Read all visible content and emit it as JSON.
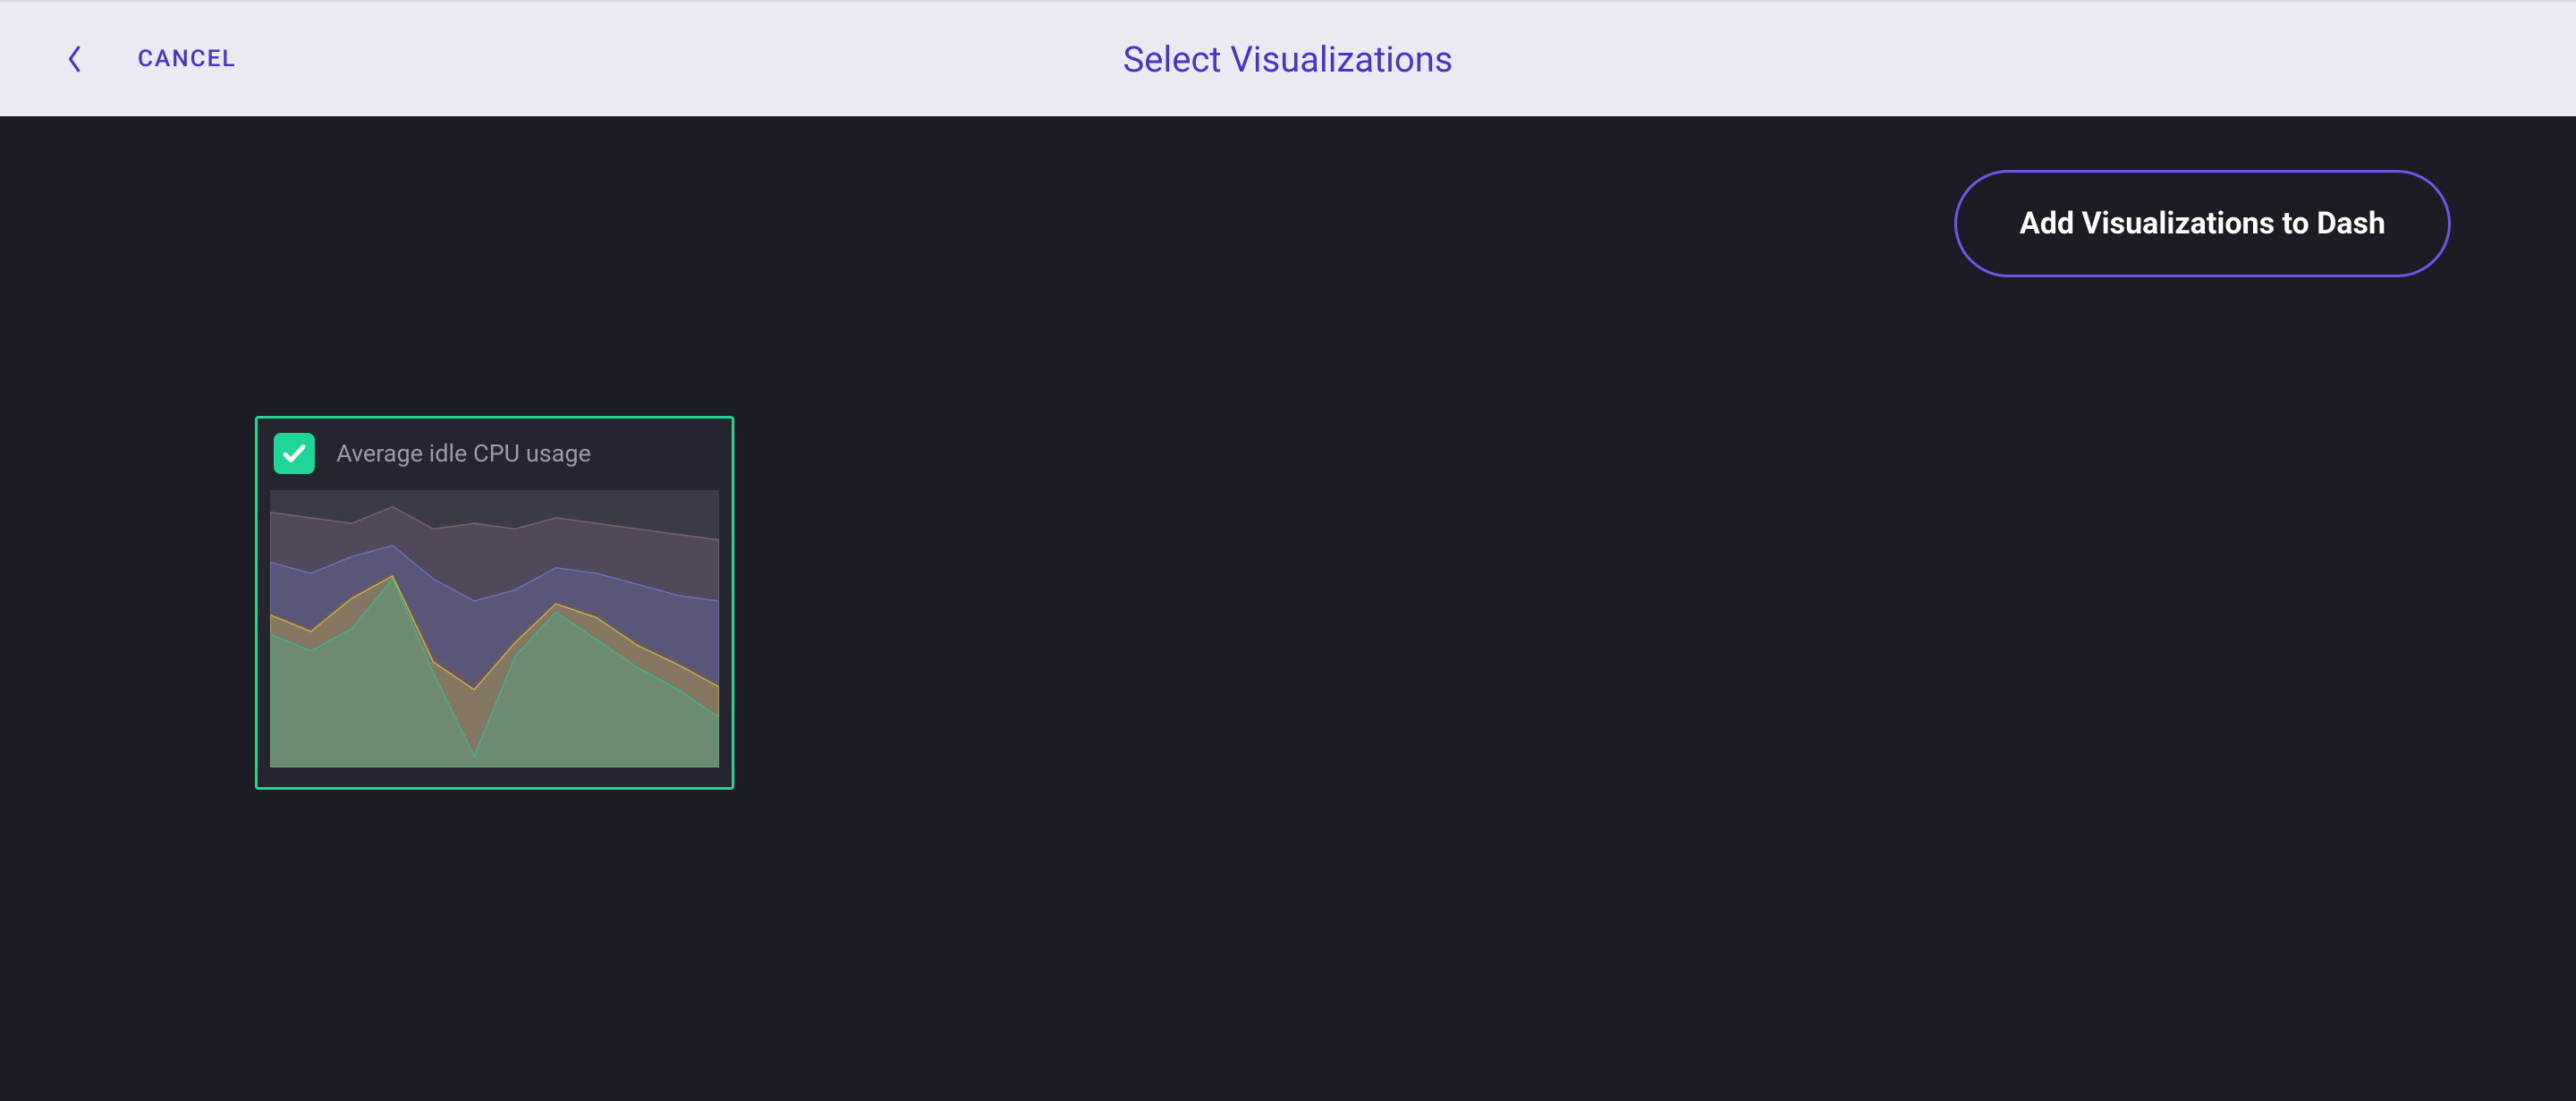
{
  "header": {
    "cancel_label": "CANCEL",
    "title": "Select Visualizations"
  },
  "actions": {
    "add_label": "Add Visualizations to Dash"
  },
  "visualizations": [
    {
      "title": "Average idle CPU usage",
      "selected": true
    }
  ],
  "chart_data": {
    "type": "area",
    "title": "Average idle CPU usage",
    "xlabel": "",
    "ylabel": "",
    "ylim": [
      0,
      100
    ],
    "x": [
      0,
      1,
      2,
      3,
      4,
      5,
      6,
      7,
      8,
      9,
      10,
      11
    ],
    "series": [
      {
        "name": "series-purple-top",
        "color": "#7a607d",
        "values": [
          92,
          90,
          88,
          94,
          86,
          88,
          86,
          90,
          88,
          86,
          84,
          82
        ]
      },
      {
        "name": "series-blue",
        "color": "#6a74b8",
        "values": [
          74,
          70,
          76,
          80,
          68,
          60,
          64,
          72,
          70,
          66,
          62,
          60
        ]
      },
      {
        "name": "series-brown",
        "color": "#6d5a55",
        "values": [
          56,
          50,
          62,
          70,
          40,
          30,
          46,
          60,
          55,
          45,
          38,
          30
        ]
      },
      {
        "name": "series-yellow",
        "color": "#c9b24a",
        "values": [
          55,
          49,
          61,
          69,
          38,
          28,
          45,
          59,
          54,
          44,
          37,
          29
        ]
      },
      {
        "name": "series-green",
        "color": "#3eb489",
        "values": [
          48,
          42,
          50,
          68,
          34,
          4,
          40,
          56,
          46,
          36,
          28,
          18
        ]
      }
    ]
  },
  "colors": {
    "accent": "#6a59e6",
    "select": "#1fd697",
    "header_bg": "#ebeaf2",
    "body_bg": "#1c1c25"
  }
}
